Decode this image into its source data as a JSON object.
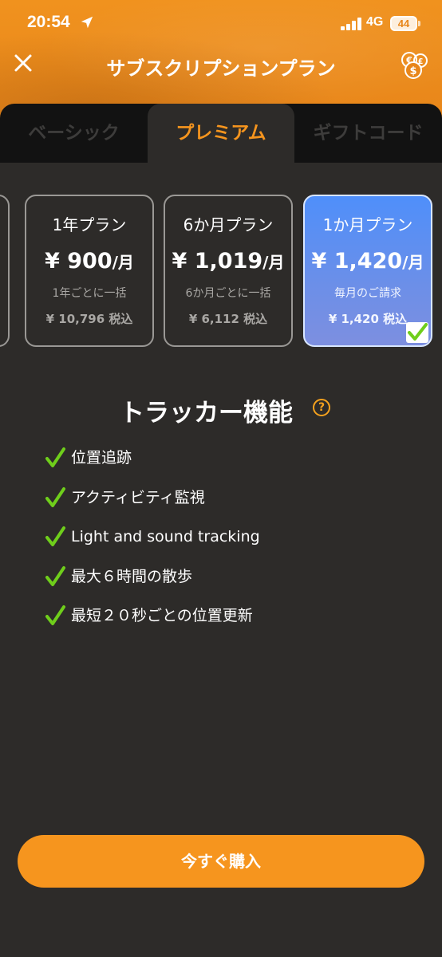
{
  "status_bar": {
    "time": "20:54",
    "network": "4G",
    "battery": "44"
  },
  "header": {
    "title": "サブスクリプションプラン"
  },
  "tabs": [
    {
      "label": "ベーシック",
      "active": false
    },
    {
      "label": "プレミアム",
      "active": true
    },
    {
      "label": "ギフトコード",
      "active": false
    }
  ],
  "plans": [
    {
      "name": "1年プラン",
      "price": "¥ 900",
      "unit": "/月",
      "billing": "1年ごとに一括",
      "total": "¥ 10,796 税込",
      "selected": false
    },
    {
      "name": "6か月プラン",
      "price": "¥ 1,019",
      "unit": "/月",
      "billing": "6か月ごとに一括",
      "total": "¥ 6,112 税込",
      "selected": false
    },
    {
      "name": "1か月プラン",
      "price": "¥ 1,420",
      "unit": "/月",
      "billing": "毎月のご請求",
      "total": "¥ 1,420 税込",
      "selected": true
    }
  ],
  "features": {
    "title": "トラッカー機能",
    "help": "?",
    "items": [
      "位置追跡",
      "アクティビティ監視",
      "Light and sound tracking",
      "最大６時間の散歩",
      "最短２０秒ごとの位置更新"
    ]
  },
  "buy_button": {
    "label": "今すぐ購入"
  },
  "colors": {
    "accent": "#f6951e",
    "selected_card": "#5a8ff4",
    "background": "#2d2b29",
    "check": "#6fce1b"
  }
}
